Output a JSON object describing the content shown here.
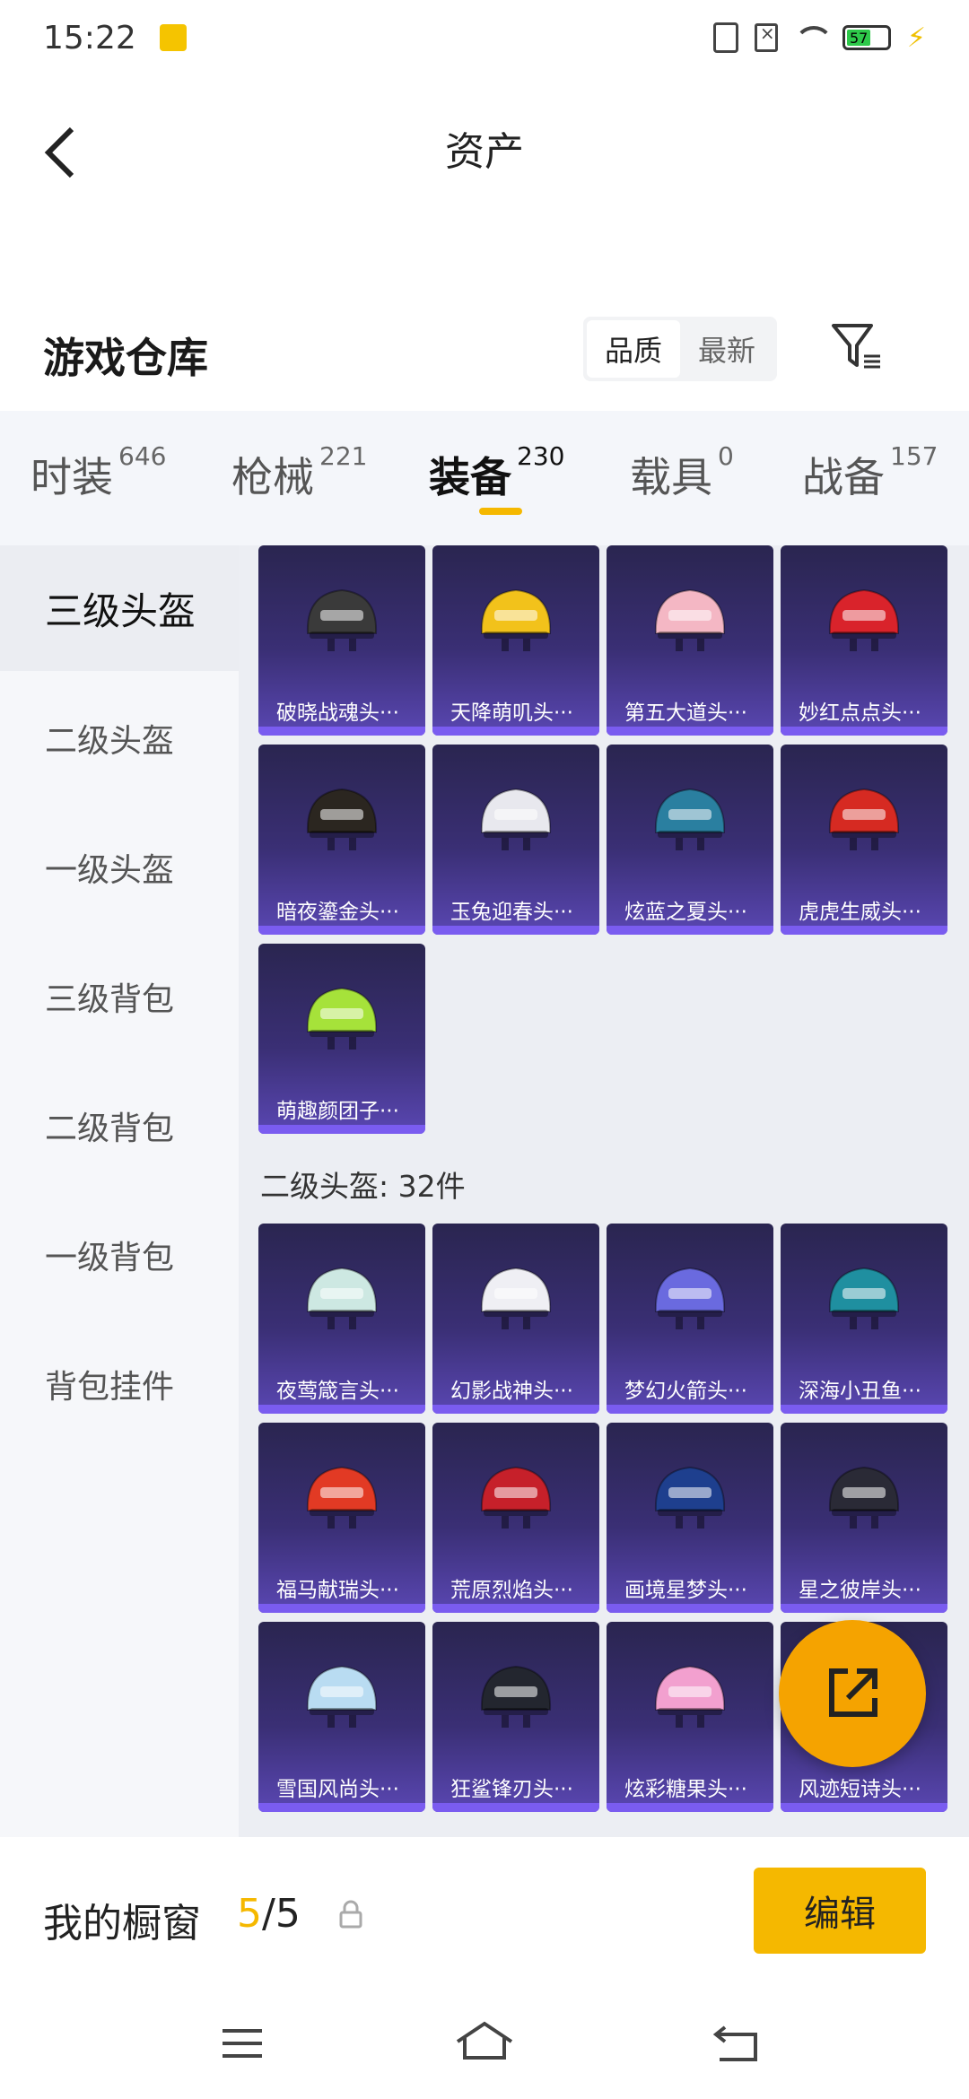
{
  "status_bar": {
    "time": "15:22",
    "battery": "57"
  },
  "header": {
    "title": "资产"
  },
  "warehouse": {
    "title": "游戏仓库",
    "sort_options": [
      "品质",
      "最新"
    ]
  },
  "tabs": [
    {
      "label": "时装",
      "count": "646"
    },
    {
      "label": "枪械",
      "count": "221"
    },
    {
      "label": "装备",
      "count": "230"
    },
    {
      "label": "载具",
      "count": "0"
    },
    {
      "label": "战备",
      "count": "157"
    }
  ],
  "active_tab": "装备",
  "sidebar": [
    {
      "label": "三级头盔"
    },
    {
      "label": "二级头盔"
    },
    {
      "label": "一级头盔"
    },
    {
      "label": "三级背包"
    },
    {
      "label": "二级背包"
    },
    {
      "label": "一级背包"
    },
    {
      "label": "背包挂件"
    }
  ],
  "sections": [
    {
      "label": "",
      "items": [
        {
          "name": "破晓战魂头···",
          "color": "#3a3a3a"
        },
        {
          "name": "天降萌叽头···",
          "color": "#f2c21b"
        },
        {
          "name": "第五大道头···",
          "color": "#f4b7c4"
        },
        {
          "name": "妙红点点头···",
          "color": "#d9232b"
        },
        {
          "name": "暗夜鎏金头···",
          "color": "#2b2620"
        },
        {
          "name": "玉兔迎春头···",
          "color": "#e8e8ee"
        },
        {
          "name": "炫蓝之夏头···",
          "color": "#2a7fa0"
        },
        {
          "name": "虎虎生威头···",
          "color": "#d62a22"
        },
        {
          "name": "萌趣颜团子···",
          "color": "#a6e23a"
        }
      ]
    },
    {
      "label": "二级头盔: 32件",
      "items": [
        {
          "name": "夜莺箴言头···",
          "color": "#cde8e2"
        },
        {
          "name": "幻影战神头···",
          "color": "#efeff4"
        },
        {
          "name": "梦幻火箭头···",
          "color": "#6a6adf"
        },
        {
          "name": "深海小丑鱼···",
          "color": "#1f8fa0"
        },
        {
          "name": "福马献瑞头···",
          "color": "#e23a24"
        },
        {
          "name": "荒原烈焰头···",
          "color": "#c6202a"
        },
        {
          "name": "画境星梦头···",
          "color": "#1e3f8e"
        },
        {
          "name": "星之彼岸头···",
          "color": "#2a2a36"
        },
        {
          "name": "雪国风尚头···",
          "color": "#b9dcf2"
        },
        {
          "name": "狂鲨锋刃头···",
          "color": "#23262f"
        },
        {
          "name": "炫彩糖果头···",
          "color": "#f2a0cf"
        },
        {
          "name": "风迹短诗头···",
          "color": "#e9e4ff"
        }
      ]
    }
  ],
  "window": {
    "title": "我的橱窗",
    "current": "5",
    "total": "/5",
    "edit_label": "编辑"
  }
}
